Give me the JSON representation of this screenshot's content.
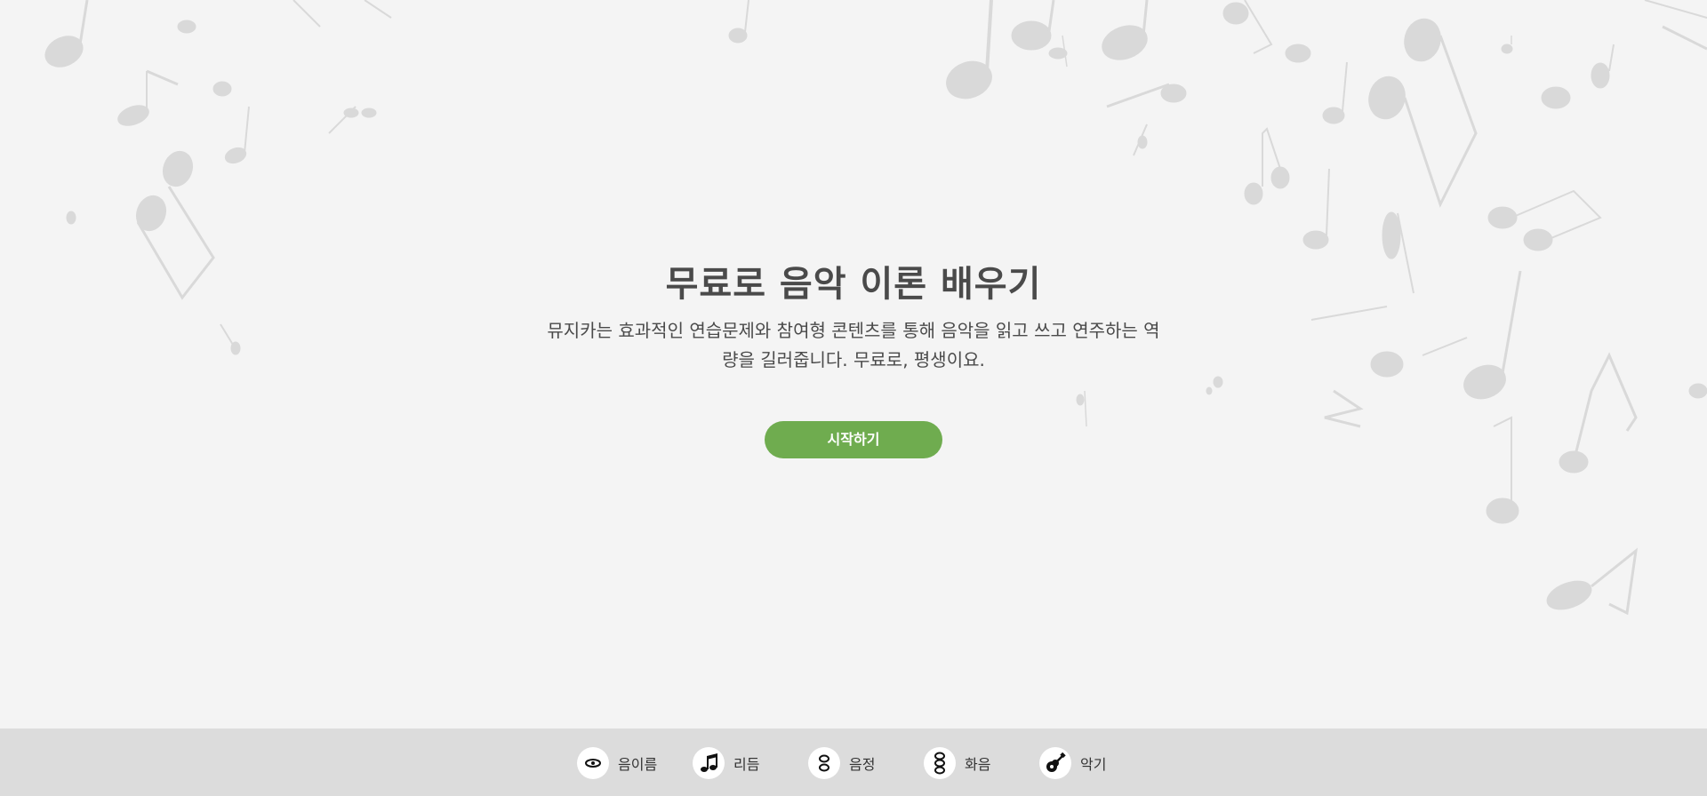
{
  "hero": {
    "title": "무료로 음악 이론 배우기",
    "subtitle": "뮤지카는 효과적인 연습문제와 참여형 콘텐츠를 통해 음악을 읽고 쓰고 연주하는 역량을 길러줍니다. 무료로, 평생이요.",
    "start_label": "시작하기"
  },
  "nav": {
    "items": [
      {
        "label": "음이름",
        "icon": "eye-icon"
      },
      {
        "label": "리듬",
        "icon": "music-note-icon"
      },
      {
        "label": "음정",
        "icon": "interval-icon"
      },
      {
        "label": "화음",
        "icon": "chord-icon"
      },
      {
        "label": "악기",
        "icon": "guitar-icon"
      }
    ]
  },
  "colors": {
    "background": "#f4f4f4",
    "accent": "#6fac4f",
    "bottom_bar": "#dcdcdc",
    "text": "#4a4a4a",
    "notes": "#d6d6d6"
  }
}
